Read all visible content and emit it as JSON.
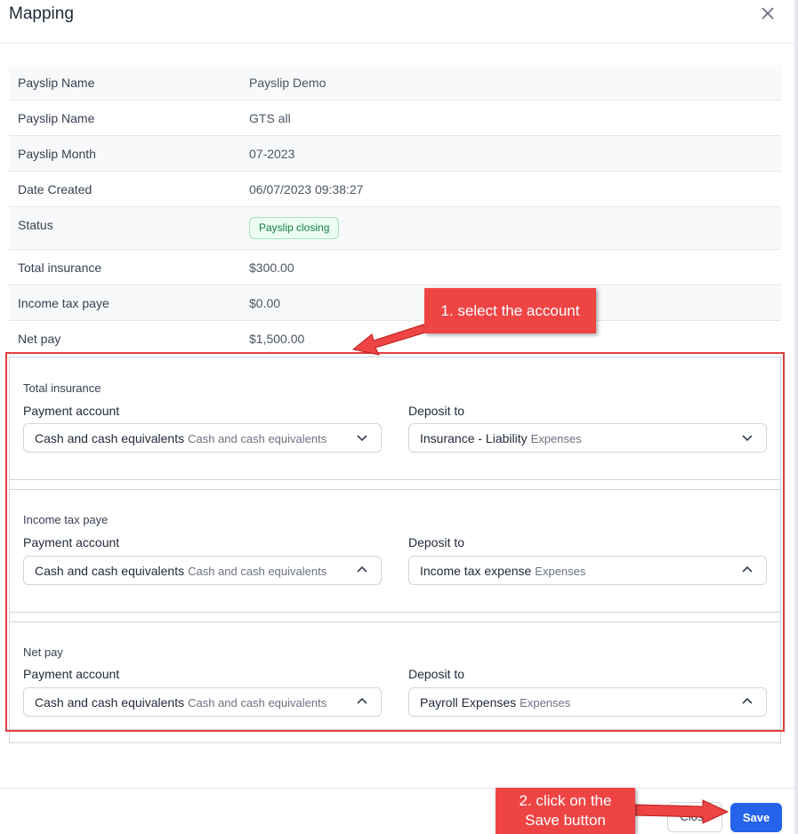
{
  "dialog": {
    "title": "Mapping",
    "close_icon": "close-icon"
  },
  "info": [
    {
      "label": "Payslip Name",
      "value": "Payslip Demo"
    },
    {
      "label": "Payslip Name",
      "value": "GTS all"
    },
    {
      "label": "Payslip Month",
      "value": "07-2023"
    },
    {
      "label": "Date Created",
      "value": "06/07/2023 09:38:27"
    },
    {
      "label": "Status",
      "badge": "Payslip closing"
    },
    {
      "label": "Total insurance",
      "value": "$300.00"
    },
    {
      "label": "Income tax paye",
      "value": "$0.00"
    },
    {
      "label": "Net pay",
      "value": "$1,500.00"
    }
  ],
  "mapping": {
    "payment_label": "Payment account",
    "deposit_label": "Deposit to",
    "sections": [
      {
        "title": "Total insurance",
        "payment": {
          "value": "Cash and cash equivalents",
          "sub": "Cash and cash equivalents",
          "chevron": "chevron-down-icon"
        },
        "deposit": {
          "value": "Insurance - Liability",
          "sub": "Expenses",
          "chevron": "chevron-down-icon"
        }
      },
      {
        "title": "Income tax paye",
        "payment": {
          "value": "Cash and cash equivalents",
          "sub": "Cash and cash equivalents",
          "chevron": "chevron-up-icon"
        },
        "deposit": {
          "value": "Income tax expense",
          "sub": "Expenses",
          "chevron": "chevron-up-icon"
        }
      },
      {
        "title": "Net pay",
        "payment": {
          "value": "Cash and cash equivalents",
          "sub": "Cash and cash equivalents",
          "chevron": "chevron-up-icon"
        },
        "deposit": {
          "value": "Payroll Expenses",
          "sub": "Expenses",
          "chevron": "chevron-up-icon"
        }
      }
    ]
  },
  "annotations": {
    "step1": "1. select the account",
    "step2_line1": "2. click on the",
    "step2_line2": "Save button",
    "highlight_color": "#e53e3e",
    "callout_color": "#ef4444"
  },
  "footer": {
    "close_label": "Close",
    "save_label": "Save"
  },
  "colors": {
    "primary": "#2563eb",
    "badge_text": "#15803d",
    "badge_bg": "#ecfdf3"
  }
}
